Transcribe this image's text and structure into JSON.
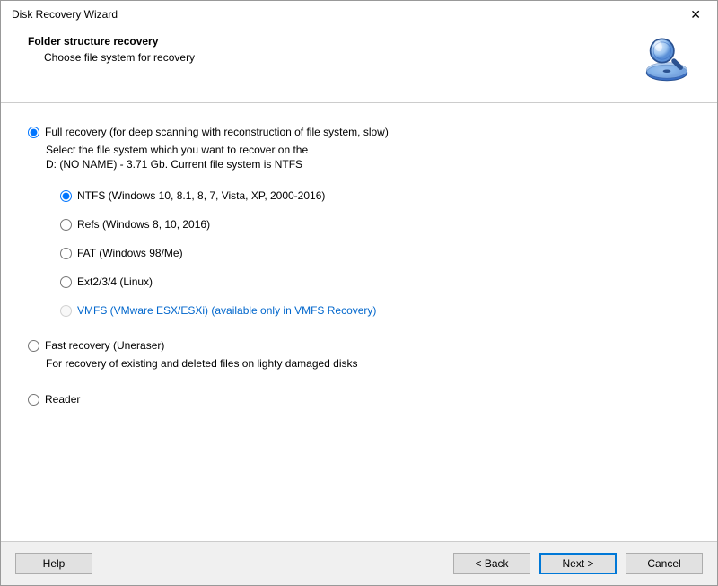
{
  "window": {
    "title": "Disk Recovery Wizard"
  },
  "header": {
    "title": "Folder structure recovery",
    "subtitle": "Choose file system for recovery"
  },
  "options": {
    "full": {
      "label": "Full recovery (for deep scanning with reconstruction of file system, slow)",
      "desc_line1": "Select the file system which you want to recover on the",
      "desc_line2": "D: (NO NAME) - 3.71 Gb. Current file system is NTFS",
      "fs": {
        "ntfs": "NTFS (Windows 10, 8.1, 8, 7, Vista, XP, 2000-2016)",
        "refs": "Refs (Windows 8, 10, 2016)",
        "fat": "FAT (Windows 98/Me)",
        "ext": "Ext2/3/4 (Linux)",
        "vmfs": "VMFS (VMware ESX/ESXi) (available only in VMFS Recovery)"
      }
    },
    "fast": {
      "label": "Fast recovery (Uneraser)",
      "desc": "For recovery of existing and deleted files on lighty damaged disks"
    },
    "reader": {
      "label": "Reader"
    }
  },
  "buttons": {
    "help": "Help",
    "back": "< Back",
    "next": "Next >",
    "cancel": "Cancel"
  }
}
